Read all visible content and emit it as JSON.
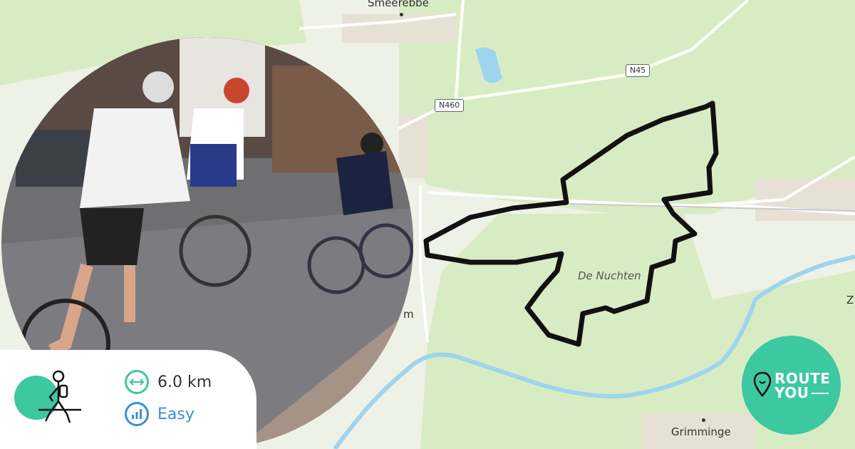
{
  "map": {
    "places": {
      "smeerebbe": "Smeerebbe",
      "de_nuchten": "De Nuchten",
      "grimminge": "Grimminge",
      "edge_z": "Z",
      "edge_m": "m"
    },
    "roads": {
      "n45": "N45",
      "n460": "N460"
    },
    "colors": {
      "background": "#e9efe0",
      "fields": "#d8ecc4",
      "water": "#9ed4ee",
      "route": "#111111"
    }
  },
  "info_card": {
    "activity_icon": "hiker-icon",
    "distance": "6.0 km",
    "difficulty": "Easy",
    "distance_color": "#3cc8a0",
    "difficulty_color": "#3a8fd6"
  },
  "logo": {
    "line1": "ROUTE",
    "line2": "YOU",
    "color": "#3cc8a0"
  }
}
